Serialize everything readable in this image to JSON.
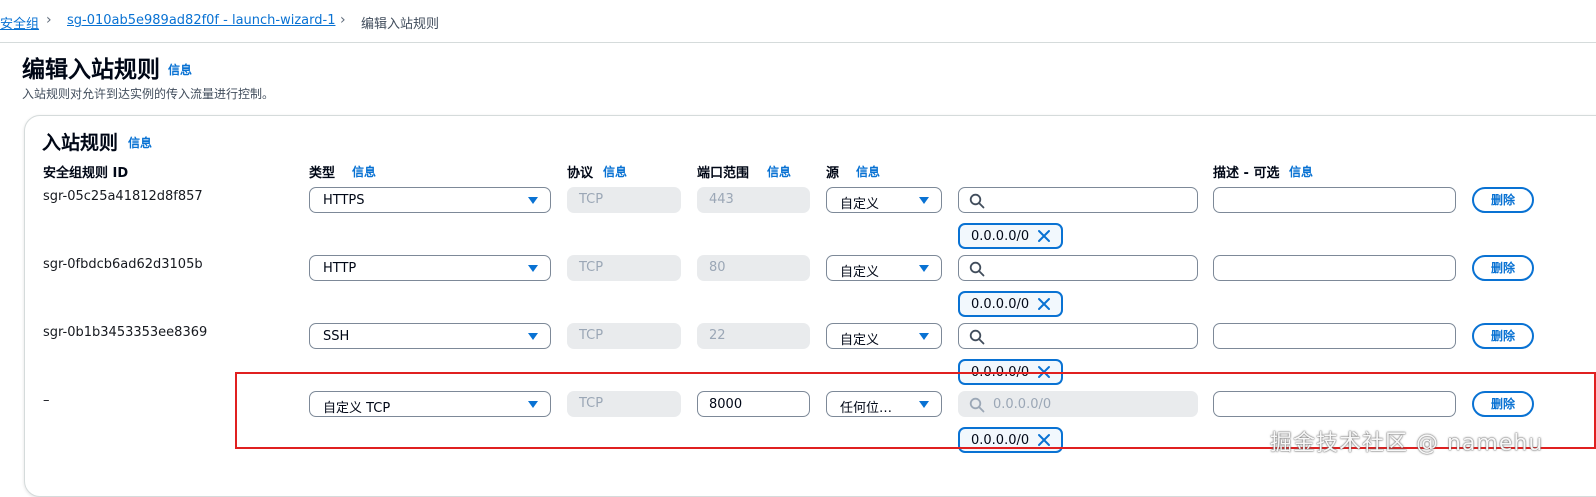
{
  "breadcrumb": {
    "items": [
      "安全组",
      "sg-010ab5e989ad82f0f - launch-wizard-1",
      "编辑入站规则"
    ]
  },
  "page": {
    "title": "编辑入站规则",
    "info": "信息",
    "description": "入站规则对允许到达实例的传入流量进行控制。"
  },
  "panel": {
    "title": "入站规则",
    "info": "信息"
  },
  "columns": {
    "rule_id": "安全组规则 ID",
    "type": "类型",
    "protocol": "协议",
    "port_range": "端口范围",
    "source": "源",
    "description": "描述 - 可选",
    "info": "信息"
  },
  "rules": [
    {
      "id": "sgr-05c25a41812d8f857",
      "type": "HTTPS",
      "protocol": "TCP",
      "port": "443",
      "source": "自定义",
      "search_placeholder": "",
      "cidr": "0.0.0.0/0",
      "description": "",
      "delete_label": "删除"
    },
    {
      "id": "sgr-0fbdcb6ad62d3105b",
      "type": "HTTP",
      "protocol": "TCP",
      "port": "80",
      "source": "自定义",
      "search_placeholder": "",
      "cidr": "0.0.0.0/0",
      "description": "",
      "delete_label": "删除"
    },
    {
      "id": "sgr-0b1b3453353ee8369",
      "type": "SSH",
      "protocol": "TCP",
      "port": "22",
      "source": "自定义",
      "search_placeholder": "",
      "cidr": "0.0.0.0/0",
      "description": "",
      "delete_label": "删除"
    },
    {
      "id": "–",
      "type": "自定义 TCP",
      "protocol": "TCP",
      "port": "8000",
      "source": "任何位…",
      "search_placeholder": "0.0.0.0/0",
      "cidr": "0.0.0.0/0",
      "description": "",
      "delete_label": "删除"
    }
  ],
  "watermark": "掘金技术社区 @ namehu",
  "colors": {
    "accent": "#0972d3",
    "highlight": "#e02020"
  }
}
